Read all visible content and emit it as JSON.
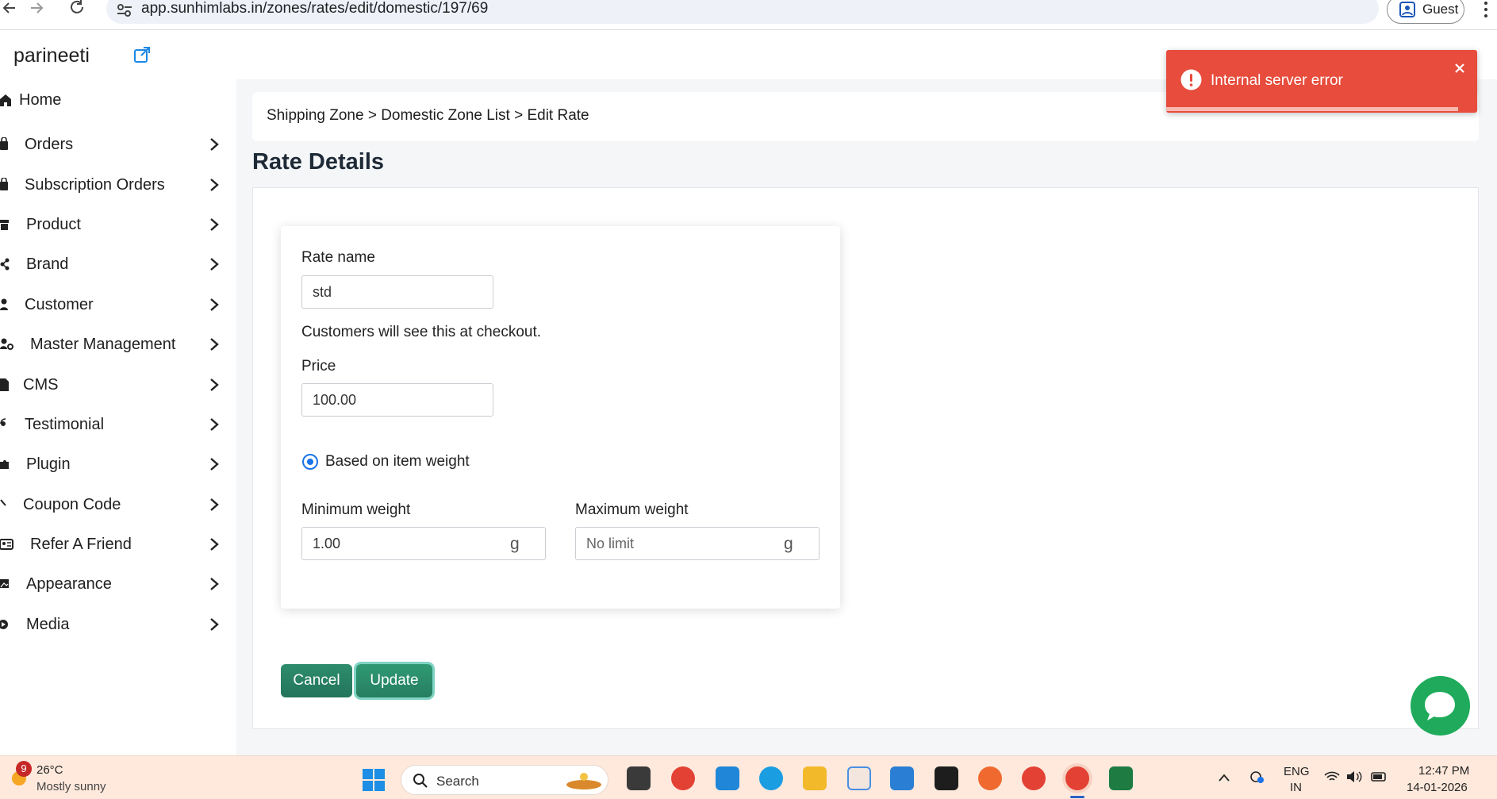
{
  "browser": {
    "url": "app.sunhimlabs.in/zones/rates/edit/domestic/197/69",
    "profile_label": "Guest"
  },
  "header": {
    "store_name": "parineeti"
  },
  "sidebar": {
    "items": [
      {
        "label": "Home",
        "icon": "home-icon",
        "has_chevron": false
      },
      {
        "label": "Orders",
        "icon": "shopping-bag-icon",
        "has_chevron": true
      },
      {
        "label": "Subscription Orders",
        "icon": "shopping-bag-icon",
        "has_chevron": true
      },
      {
        "label": "Product",
        "icon": "archive-icon",
        "has_chevron": true
      },
      {
        "label": "Brand",
        "icon": "share-icon",
        "has_chevron": true
      },
      {
        "label": "Customer",
        "icon": "user-icon",
        "has_chevron": true
      },
      {
        "label": "Master Management",
        "icon": "user-gear-icon",
        "has_chevron": true
      },
      {
        "label": "CMS",
        "icon": "file-icon",
        "has_chevron": true
      },
      {
        "label": "Testimonial",
        "icon": "quote-icon",
        "has_chevron": true
      },
      {
        "label": "Plugin",
        "icon": "puzzle-icon",
        "has_chevron": true
      },
      {
        "label": "Coupon Code",
        "icon": "tag-icon",
        "has_chevron": true
      },
      {
        "label": "Refer A Friend",
        "icon": "address-card-icon",
        "has_chevron": true
      },
      {
        "label": "Appearance",
        "icon": "image-icon",
        "has_chevron": true
      },
      {
        "label": "Media",
        "icon": "play-icon",
        "has_chevron": true
      }
    ]
  },
  "breadcrumb": {
    "text": "Shipping Zone > Domestic Zone List > Edit Rate"
  },
  "page": {
    "title": "Rate Details"
  },
  "form": {
    "rate_name_label": "Rate name",
    "rate_name_value": "std",
    "rate_name_help": "Customers will see this at checkout.",
    "price_label": "Price",
    "price_value": "100.00",
    "condition_option": "Based on item weight",
    "condition_selected": true,
    "min_weight_label": "Minimum weight",
    "min_weight_value": "1.00",
    "min_weight_unit": "g",
    "max_weight_label": "Maximum weight",
    "max_weight_placeholder": "No limit",
    "max_weight_unit": "g"
  },
  "actions": {
    "cancel_label": "Cancel",
    "update_label": "Update"
  },
  "toast": {
    "message": "Internal server error",
    "progress": 0.94
  },
  "taskbar": {
    "weather_badge": "9",
    "temperature": "26°C",
    "weather_text": "Mostly sunny",
    "search_label": "Search",
    "language_top": "ENG",
    "language_bottom": "IN",
    "time": "12:47 PM",
    "date": "14-01-2026"
  },
  "colors": {
    "primary_green": "#23745a",
    "toast_red": "#e74c3c",
    "radio_blue": "#1a73e8",
    "chat_green": "#1fab5b"
  }
}
